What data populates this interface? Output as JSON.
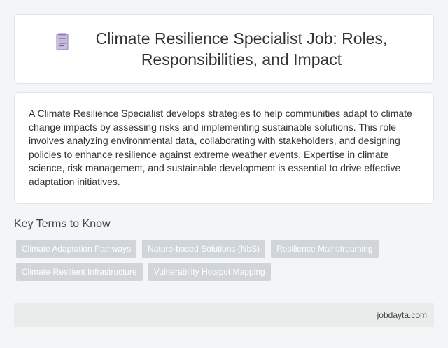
{
  "header": {
    "title": "Climate Resilience Specialist Job: Roles, Responsibilities, and Impact",
    "icon": "document-icon"
  },
  "summary": {
    "text": "A Climate Resilience Specialist develops strategies to help communities adapt to climate change impacts by assessing risks and implementing sustainable solutions. This role involves analyzing environmental data, collaborating with stakeholders, and designing policies to enhance resilience against extreme weather events. Expertise in climate science, risk management, and sustainable development is essential to drive effective adaptation initiatives."
  },
  "key_terms": {
    "heading": "Key Terms to Know",
    "tags": [
      "Climate Adaptation Pathways",
      "Nature-based Solutions (NbS)",
      "Resilience Mainstreaming",
      "Climate-Resilient Infrastructure",
      "Vulnerability Hotspot Mapping"
    ]
  },
  "footer": {
    "site": "jobdayta.com"
  },
  "colors": {
    "background": "#f3f5f7",
    "card": "#ffffff",
    "tag": "#d0d5da",
    "footer": "#e8edeb",
    "icon": "#b9a9d6"
  }
}
